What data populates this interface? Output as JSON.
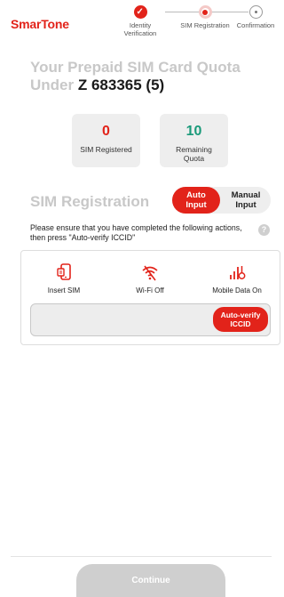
{
  "brand": {
    "logo": "SmarTone",
    "accent_color": "#e2231a"
  },
  "steps": [
    {
      "label": "Identity Verification",
      "state": "done",
      "icon": "check-icon"
    },
    {
      "label": "SIM Registration",
      "state": "active",
      "icon": "dot-icon"
    },
    {
      "label": "Confirmation",
      "state": "todo",
      "icon": "dot-icon"
    }
  ],
  "quota": {
    "title_prefix": "Your Prepaid SIM Card Quota Under",
    "title_id": "Z 683365 (5)",
    "registered": {
      "value": "0",
      "label": "SIM Registered",
      "color": "#e2231a"
    },
    "remaining": {
      "value": "10",
      "label": "Remaining Quota",
      "color": "#1a9a7a"
    }
  },
  "sim_registration": {
    "title": "SIM Registration",
    "toggle": {
      "auto": "Auto Input",
      "manual": "Manual Input",
      "selected": "auto"
    },
    "instruction": "Please ensure that you have completed the following actions, then press \"Auto-verify ICCID\"",
    "help_icon": "?",
    "actions": [
      {
        "label": "Insert SIM",
        "icon": "phone-sim-icon"
      },
      {
        "label": "Wi-Fi Off",
        "icon": "wifi-off-icon"
      },
      {
        "label": "Mobile Data On",
        "icon": "signal-bars-icon"
      }
    ],
    "iccid_value": "",
    "verify_button": "Auto-verify ICCID"
  },
  "footer": {
    "continue_label": "Continue",
    "continue_enabled": false
  }
}
